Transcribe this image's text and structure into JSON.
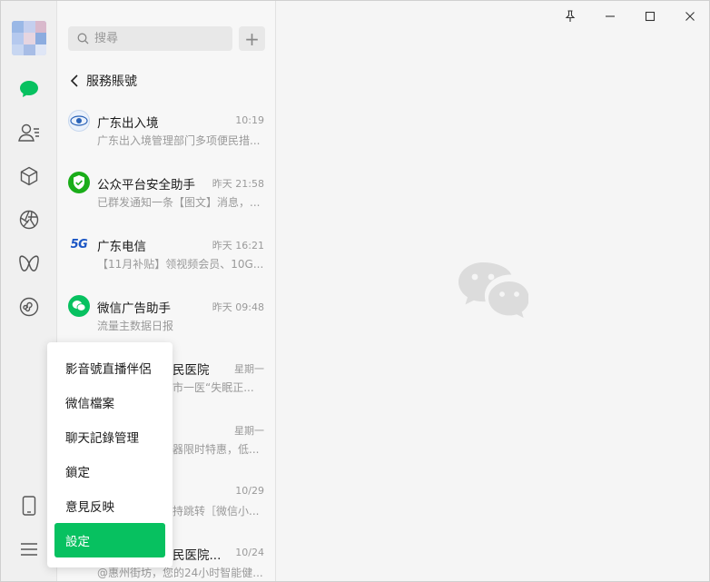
{
  "search": {
    "placeholder": "搜尋"
  },
  "header": {
    "back_title": "服務賬號"
  },
  "chats": [
    {
      "name": "广东出入境",
      "time": "10:19",
      "preview": "广东出入境管理部门多项便民措..."
    },
    {
      "name": "公众平台安全助手",
      "time": "昨天 21:58",
      "preview": "已群发通知一条【图文】消息，..."
    },
    {
      "name": "广东电信",
      "time": "昨天 16:21",
      "preview": "【11月补贴】领视频会员、10G..."
    },
    {
      "name": "微信广告助手",
      "time": "昨天 09:48",
      "preview": "流量主数据日报"
    },
    {
      "name": "民医院",
      "time": "星期一",
      "preview": "市一医“失眠正..."
    },
    {
      "name": "",
      "time": "星期一",
      "preview": "器限时特惠，低..."
    },
    {
      "name": "",
      "time": "10/29",
      "preview": "持跳转［微信小..."
    },
    {
      "name": "民医院...",
      "time": "10/24",
      "preview": "@惠州街坊，您的24小时智能健..."
    }
  ],
  "badges": {
    "5g": "5G"
  },
  "menu": {
    "items": [
      {
        "label": "影音號直播伴侶"
      },
      {
        "label": "微信檔案"
      },
      {
        "label": "聊天記錄管理"
      },
      {
        "label": "鎖定"
      },
      {
        "label": "意見反映"
      },
      {
        "label": "設定"
      }
    ]
  },
  "colors": {
    "accent": "#07c160",
    "shield": "#1aad19"
  }
}
